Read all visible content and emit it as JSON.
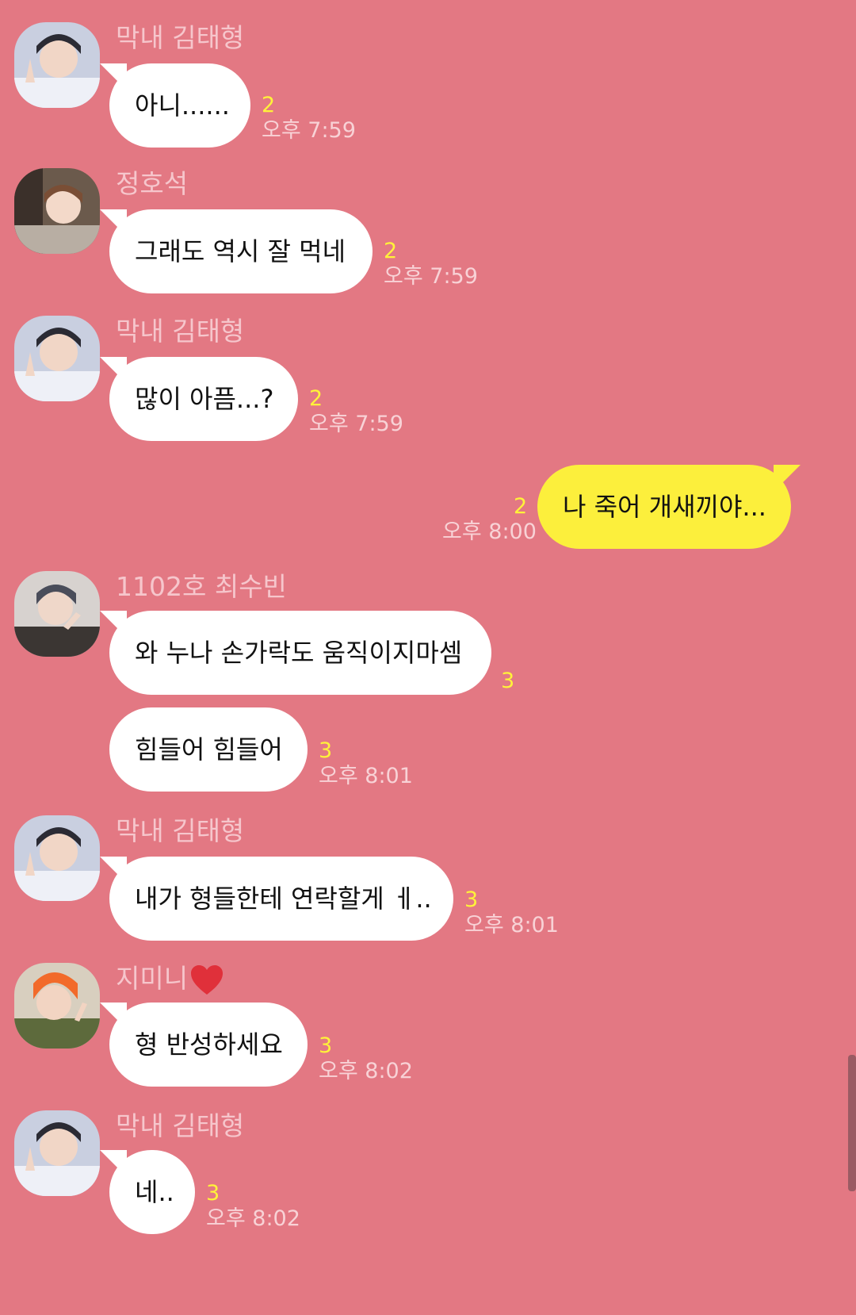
{
  "colors": {
    "background": "#e37883",
    "incoming_bubble": "#ffffff",
    "outgoing_bubble": "#fcef3c",
    "sender_name": "#f6c6cc",
    "unread_count": "#fff23a",
    "timestamp": "#f8d2d6"
  },
  "messages": [
    {
      "sender": "막내 김태형",
      "text": "아니......",
      "unread": "2",
      "time": "오후 7:59",
      "avatar": "avatar-taehyung"
    },
    {
      "sender": "정호석",
      "text": "그래도 역시 잘 먹네",
      "unread": "2",
      "time": "오후 7:59",
      "avatar": "avatar-hoseok"
    },
    {
      "sender": "막내 김태형",
      "text": "많이 아픔...?",
      "unread": "2",
      "time": "오후 7:59",
      "avatar": "avatar-taehyung"
    },
    {
      "sender": "",
      "text": "나 죽어 개새끼야...",
      "unread": "2",
      "time": "오후 8:00",
      "mine": true
    },
    {
      "sender": "1102호 최수빈",
      "text": "와 누나 손가락도 움직이지마셈",
      "unread": "3",
      "time": "",
      "avatar": "avatar-soobin"
    },
    {
      "sender": "",
      "text": "힘들어 힘들어",
      "unread": "3",
      "time": "오후 8:01"
    },
    {
      "sender": "막내 김태형",
      "text": "내가 형들한테 연락할게 ㅔ..",
      "unread": "3",
      "time": "오후 8:01",
      "avatar": "avatar-taehyung"
    },
    {
      "sender": "지미니",
      "sender_icon": "red-heart-icon",
      "text": "형 반성하세요",
      "unread": "3",
      "time": "오후 8:02",
      "avatar": "avatar-jimin"
    },
    {
      "sender": "막내 김태형",
      "text": "네..",
      "unread": "3",
      "time": "오후 8:02",
      "avatar": "avatar-taehyung"
    }
  ]
}
